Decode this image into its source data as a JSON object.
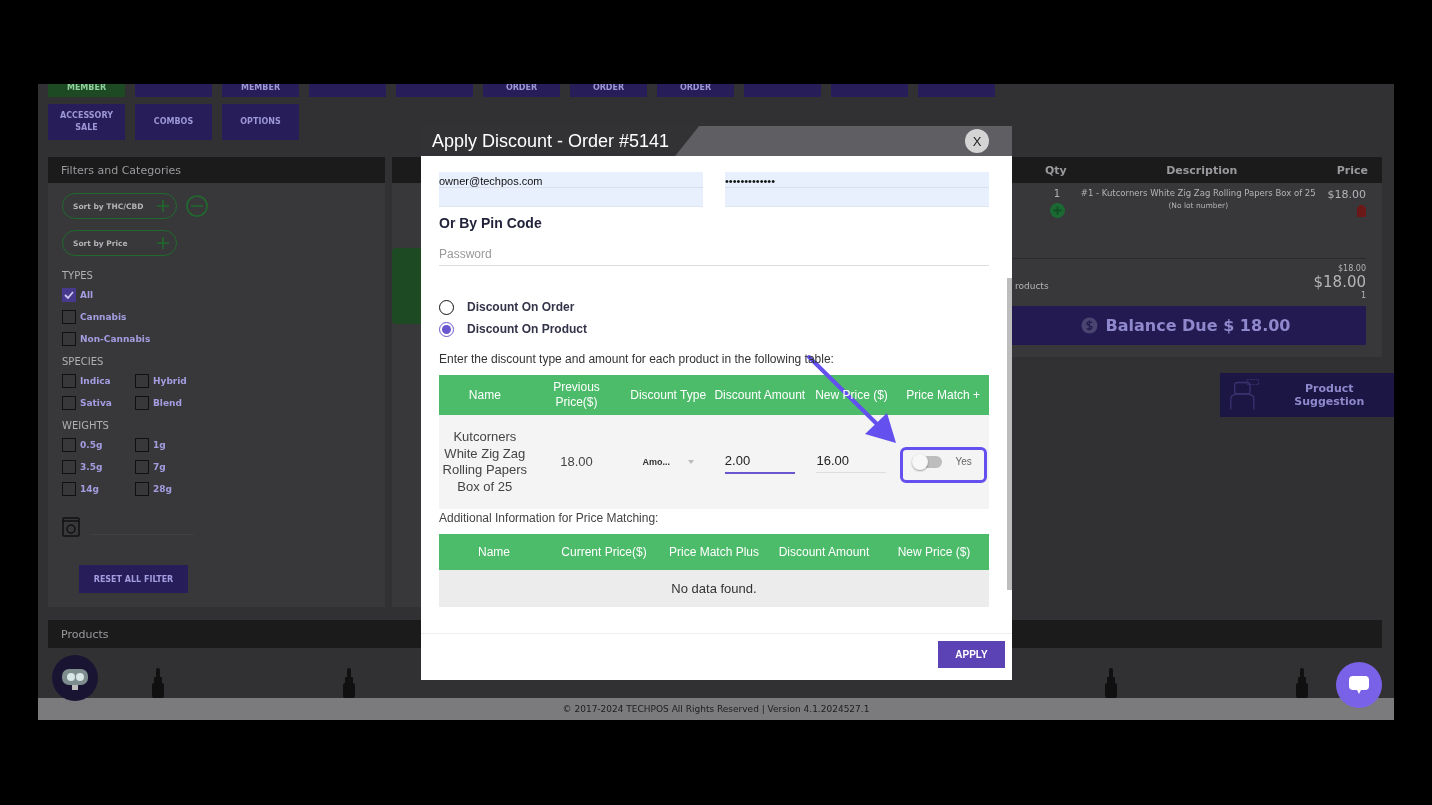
{
  "toolbar": {
    "row_1": [
      {
        "label": "MEMBER",
        "kind": "green"
      },
      {
        "kind": "purple"
      },
      {
        "label": "MEMBER",
        "kind": "purple"
      },
      {
        "kind": "purple"
      },
      {
        "kind": "purple"
      },
      {
        "label": "ORDER",
        "kind": "purple"
      },
      {
        "label": "ORDER",
        "kind": "purple"
      },
      {
        "label": "ORDER",
        "kind": "purple"
      },
      {
        "kind": "purple"
      },
      {
        "kind": "purple"
      },
      {
        "kind": "purple"
      }
    ],
    "row_2": [
      {
        "label": "ACCESSORY SALE",
        "kind": "purple"
      },
      {
        "label": "COMBOS",
        "kind": "purple"
      },
      {
        "label": "OPTIONS",
        "kind": "purple"
      }
    ]
  },
  "filters": {
    "title": "Filters and Categories",
    "sort_chips": [
      {
        "label": "Sort by THC/CBD"
      },
      {
        "label": "Sort by Price"
      }
    ],
    "groups": [
      {
        "title": "TYPES",
        "kind": "list",
        "options": [
          {
            "label": "All",
            "checked": true
          },
          {
            "label": "Cannabis",
            "checked": false
          },
          {
            "label": "Non-Cannabis",
            "checked": false
          }
        ]
      },
      {
        "title": "SPECIES",
        "kind": "grid",
        "options": [
          {
            "label": "Indica",
            "checked": false
          },
          {
            "label": "Hybrid",
            "checked": false
          },
          {
            "label": "Sativa",
            "checked": false
          },
          {
            "label": "Blend",
            "checked": false
          }
        ]
      },
      {
        "title": "WEIGHTS",
        "kind": "grid",
        "options": [
          {
            "label": "0.5g",
            "checked": false
          },
          {
            "label": "1g",
            "checked": false
          },
          {
            "label": "3.5g",
            "checked": false
          },
          {
            "label": "7g",
            "checked": false
          },
          {
            "label": "14g",
            "checked": false
          },
          {
            "label": "28g",
            "checked": false
          }
        ]
      }
    ],
    "reset_button": "RESET ALL FILTER"
  },
  "cart": {
    "columns": [
      "Qty",
      "Description",
      "Price"
    ],
    "items": [
      {
        "qty": "1",
        "description": "#1 - Kutcorners White Zig Zag Rolling Papers Box of 25",
        "lot": "(No lot number)",
        "price": "$18.00"
      }
    ],
    "subtotal": "$18.00",
    "total": "$18.00",
    "products_label": "roducts",
    "products_count": "1",
    "balance_due": "Balance Due $ 18.00"
  },
  "product_suggestion": "Product Suggestion",
  "products": {
    "title": "Products"
  },
  "footer": "© 2017-2024 TECHPOS All Rights Reserved | Version 4.1.2024527.1",
  "modal": {
    "title": "Apply Discount - Order #5141",
    "close": "X",
    "login_fields": [
      {
        "value": "owner@techpos.com"
      },
      {
        "value": "•••••••••••••"
      }
    ],
    "pin_heading": "Or By Pin Code",
    "pin_field": {
      "placeholder": "Password"
    },
    "discount_modes": [
      {
        "label": "Discount On Order",
        "selected": false
      },
      {
        "label": "Discount On Product",
        "selected": true
      }
    ],
    "instruction": "Enter the discount type and amount for each product in the following table:",
    "products_table": {
      "columns": [
        "Name",
        "Previous Price($)",
        "Discount Type",
        "Discount Amount",
        "New Price ($)",
        "Price Match +"
      ],
      "rows": [
        {
          "name": "Kutcorners White Zig Zag Rolling Papers Box of 25",
          "previous_price": "18.00",
          "discount_type": "Amo...",
          "discount_amount": "2.00",
          "new_price": "16.00",
          "price_match": {
            "label": "Yes",
            "on": false
          }
        }
      ]
    },
    "additional_info": "Additional Information for Price Matching:",
    "price_match_table": {
      "columns": [
        "Name",
        "Current Price($)",
        "Price Match Plus",
        "Discount Amount",
        "New Price ($)"
      ],
      "empty_message": "No data found."
    },
    "apply_button": "APPLY"
  }
}
